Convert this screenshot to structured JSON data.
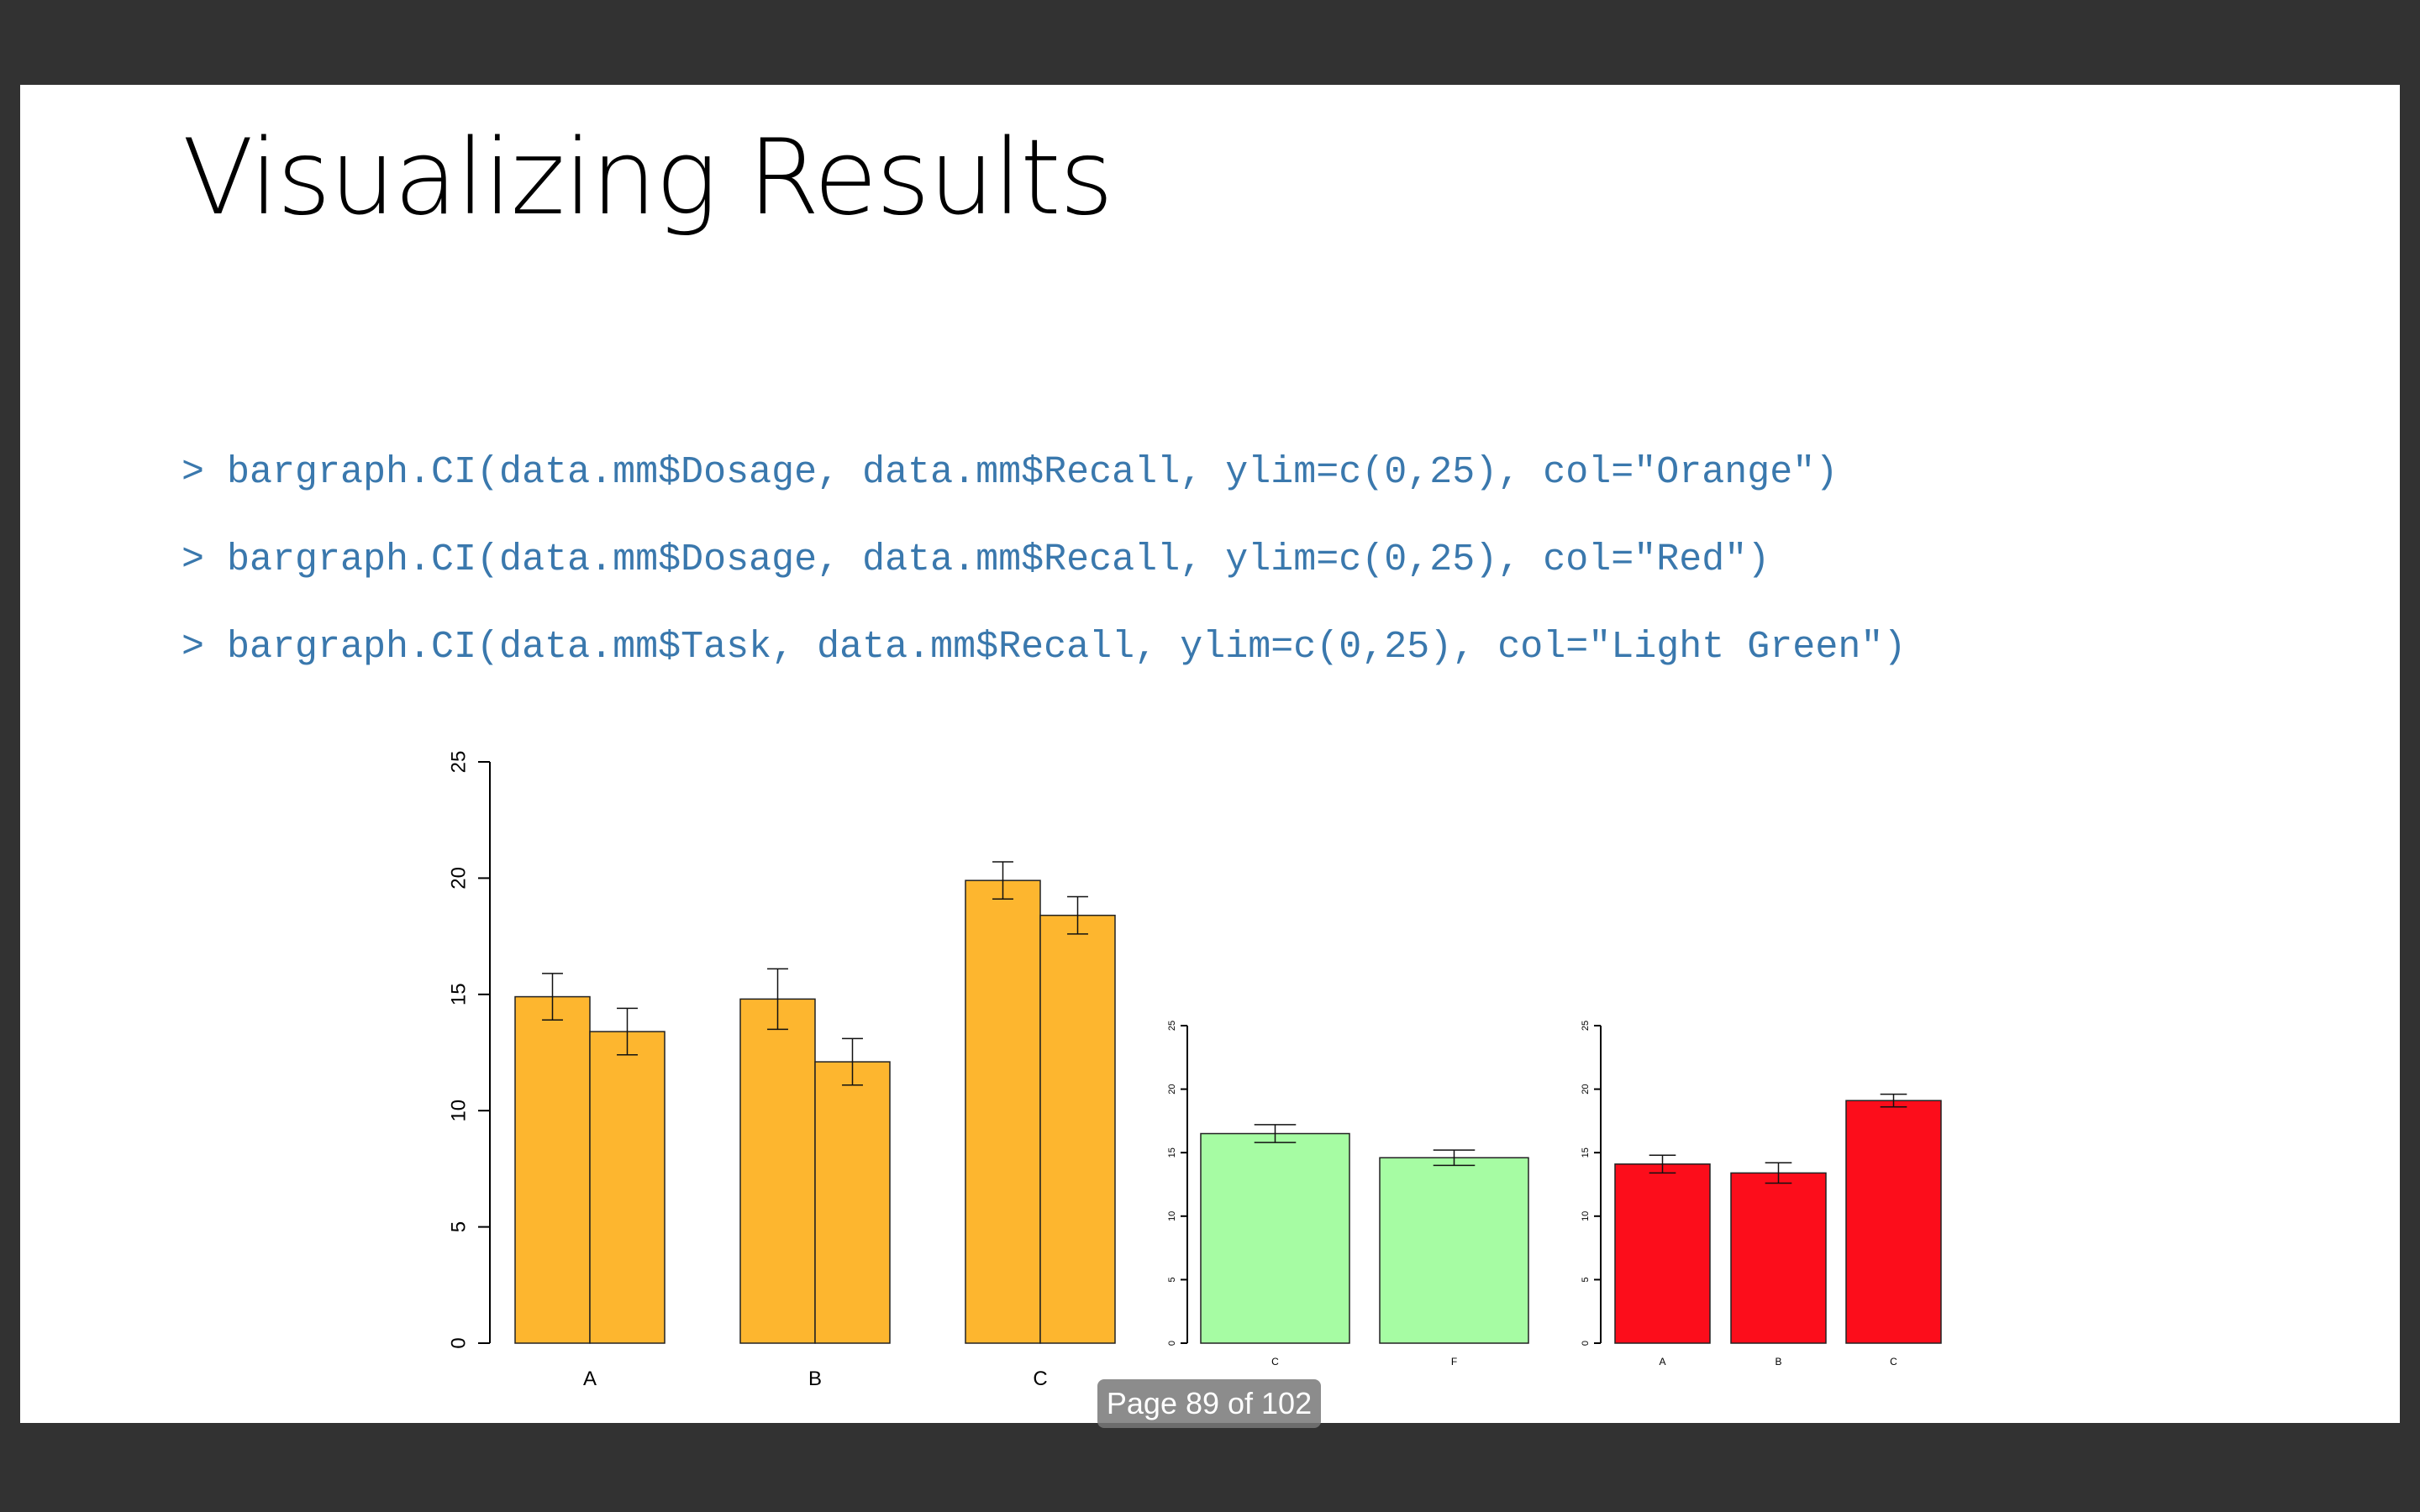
{
  "slide": {
    "title": "Visualizing Results",
    "code_lines": [
      "> bargraph.CI(data.mm$Dosage, data.mm$Recall, ylim=c(0,25), col=\"Orange\")",
      "> bargraph.CI(data.mm$Dosage, data.mm$Recall, ylim=c(0,25), col=\"Red\")",
      "> bargraph.CI(data.mm$Task, data.mm$Recall, ylim=c(0,25), col=\"Light Green\")"
    ]
  },
  "viewer": {
    "page_indicator": "Page 89 of 102"
  },
  "chart_data": [
    {
      "type": "bar",
      "grouped": true,
      "color": "#fdb62f",
      "categories": [
        "A",
        "B",
        "C"
      ],
      "series": [
        {
          "values": [
            14.9,
            14.8,
            19.9
          ],
          "error": [
            1.0,
            1.3,
            0.8
          ]
        },
        {
          "values": [
            13.4,
            12.1,
            18.4
          ],
          "error": [
            1.0,
            1.0,
            0.8
          ]
        }
      ],
      "ylim": [
        0,
        25
      ],
      "yticks": [
        0,
        5,
        10,
        15,
        20,
        25
      ]
    },
    {
      "type": "bar",
      "color": "#a6fca3",
      "categories": [
        "C",
        "F"
      ],
      "values": [
        16.5,
        14.6
      ],
      "error": [
        0.7,
        0.6
      ],
      "ylim": [
        0,
        25
      ],
      "yticks": [
        0,
        5,
        10,
        15,
        20,
        25
      ]
    },
    {
      "type": "bar",
      "color": "#fc0d1b",
      "categories": [
        "A",
        "B",
        "C"
      ],
      "values": [
        14.1,
        13.4,
        19.1
      ],
      "error": [
        0.7,
        0.8,
        0.5
      ],
      "ylim": [
        0,
        25
      ],
      "yticks": [
        0,
        5,
        10,
        15,
        20,
        25
      ]
    }
  ]
}
